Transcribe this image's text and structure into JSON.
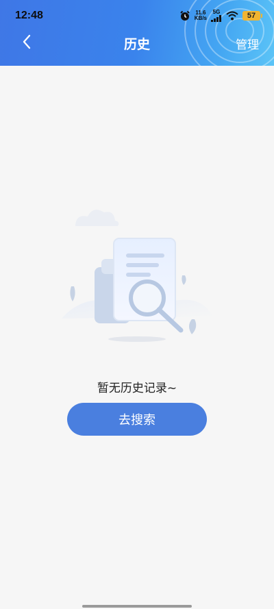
{
  "status_bar": {
    "time": "12:48",
    "net_speed_value": "11.6",
    "net_speed_unit": "KB/s",
    "network_type": "5G",
    "battery_level": "57"
  },
  "header": {
    "title": "历史",
    "manage_label": "管理",
    "back_icon": "chevron-left-icon"
  },
  "empty_state": {
    "message": "暂无历史记录~",
    "search_button_label": "去搜索"
  },
  "colors": {
    "header_start": "#3f77e6",
    "header_end": "#5bc4f7",
    "button": "#4a7fdf",
    "background": "#f6f6f6"
  }
}
